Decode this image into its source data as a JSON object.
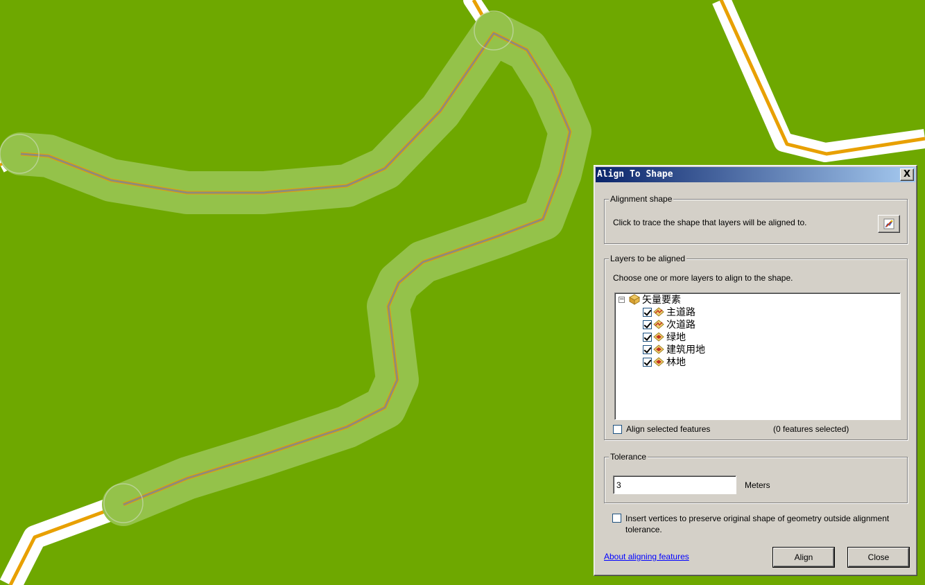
{
  "dialog": {
    "title": "Align To Shape",
    "close_label": "X"
  },
  "alignment_shape": {
    "legend": "Alignment shape",
    "description": "Click to trace the shape that layers will be aligned to."
  },
  "layers": {
    "legend": "Layers to be aligned",
    "description": "Choose one or more layers to align to the shape.",
    "root": {
      "expander": "−",
      "label": "矢量要素"
    },
    "items": [
      {
        "label": "主道路",
        "checked": true,
        "icon": "line-layer-icon"
      },
      {
        "label": "次道路",
        "checked": true,
        "icon": "line-layer-icon"
      },
      {
        "label": "绿地",
        "checked": true,
        "icon": "polygon-layer-icon"
      },
      {
        "label": "建筑用地",
        "checked": true,
        "icon": "polygon-layer-icon"
      },
      {
        "label": "林地",
        "checked": true,
        "icon": "polygon-layer-icon"
      }
    ],
    "align_selected_label": "Align selected features",
    "align_selected_checked": false,
    "selected_count": "(0 features selected)"
  },
  "tolerance": {
    "legend": "Tolerance",
    "value": "3",
    "units": "Meters"
  },
  "insert_vertices": {
    "label": "Insert vertices to preserve original shape of geometry outside alignment tolerance.",
    "checked": false
  },
  "footer": {
    "link": "About aligning features",
    "align_label": "Align",
    "close_label": "Close"
  },
  "colors": {
    "map_background": "#6ea800",
    "road_orange": "#e8a000",
    "buffer_green": "#94c24a",
    "traced_shape": "#8c8c7c",
    "titlebar_start": "#0a246a",
    "titlebar_end": "#a6caf0"
  }
}
